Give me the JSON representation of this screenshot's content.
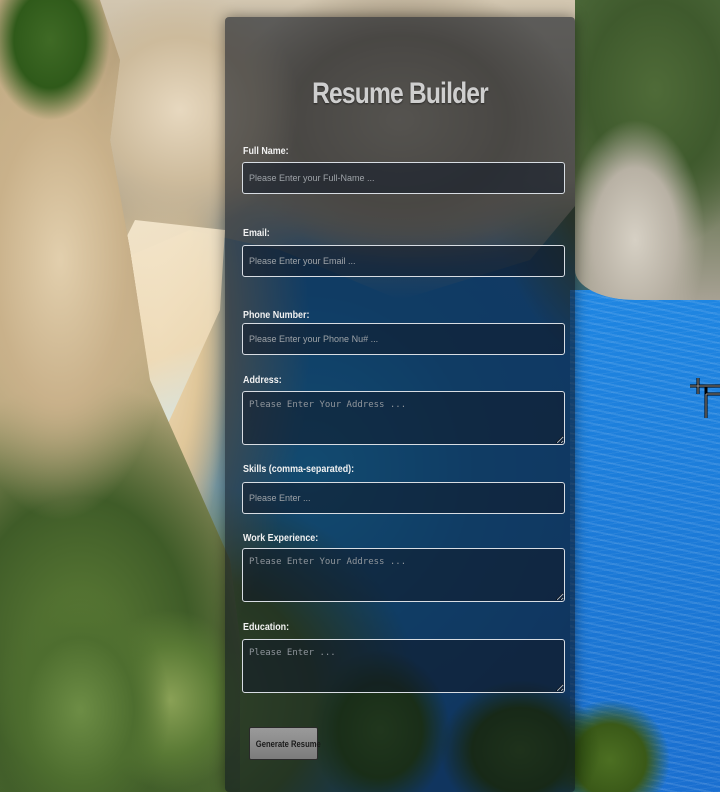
{
  "page": {
    "title": "Resume Builder"
  },
  "form": {
    "fields": [
      {
        "label": "Full Name:",
        "placeholder": "Please Enter your Full-Name ..."
      },
      {
        "label": "Email:",
        "placeholder": "Please Enter your Email ..."
      },
      {
        "label": "Phone Number:",
        "placeholder": "Please Enter your Phone Nu# ..."
      },
      {
        "label": "Address:",
        "placeholder": "Please Enter Your Address ..."
      },
      {
        "label": "Skills (comma-separated):",
        "placeholder": "Please Enter ..."
      },
      {
        "label": "Work Experience:",
        "placeholder": "Please Enter Your Address ..."
      },
      {
        "label": "Education:",
        "placeholder": "Please Enter ..."
      }
    ],
    "submit_label": "Generate Resume"
  },
  "colors": {
    "card_background": "rgba(10,18,30,0.58)",
    "input_border": "#d8dde3",
    "title_text": "#cfcfcf",
    "label_text": "#f2f2f2",
    "button_background": "#8a8a8a"
  },
  "icons": {
    "cursor": "crosshair-cursor-icon"
  }
}
